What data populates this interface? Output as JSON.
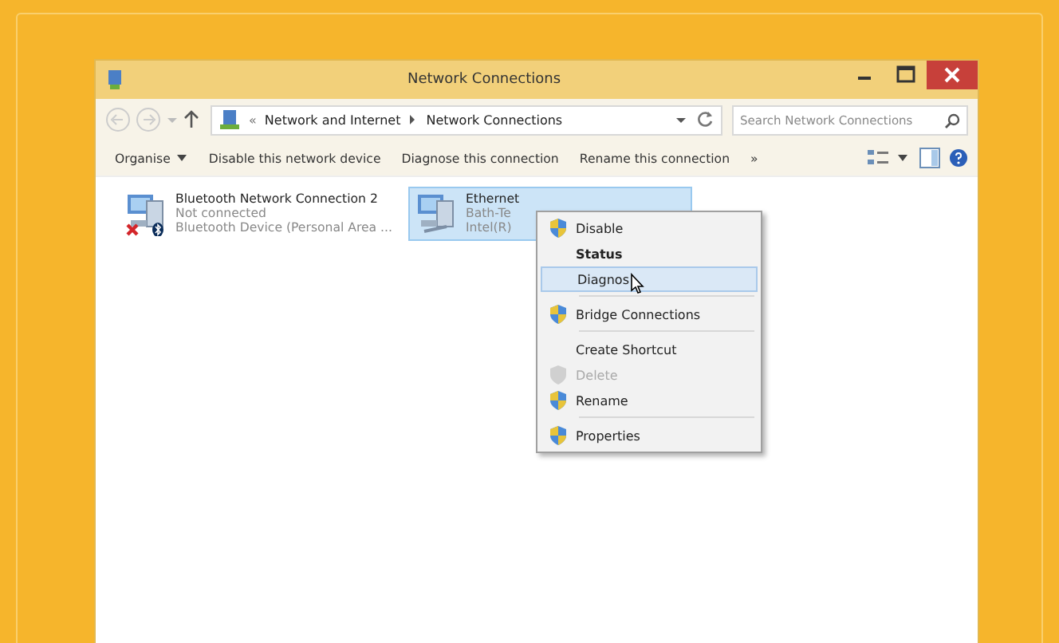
{
  "window": {
    "title": "Network Connections"
  },
  "address_bar": {
    "prefix": "«",
    "path": [
      "Network and Internet",
      "Network Connections"
    ]
  },
  "search": {
    "placeholder": "Search Network Connections"
  },
  "toolbar": {
    "items": [
      {
        "label": "Organise",
        "dropdown": true
      },
      {
        "label": "Disable this network device",
        "dropdown": false
      },
      {
        "label": "Diagnose this connection",
        "dropdown": false
      },
      {
        "label": "Rename this connection",
        "dropdown": false
      },
      {
        "label": "»",
        "dropdown": false
      }
    ]
  },
  "connections": [
    {
      "name": "Bluetooth Network Connection 2",
      "status": "Not connected",
      "device": "Bluetooth Device (Personal Area ...",
      "kind": "bluetooth",
      "selected": false
    },
    {
      "name": "Ethernet",
      "status": "Bath-Te",
      "device": "Intel(R)",
      "kind": "ethernet",
      "selected": true
    }
  ],
  "context_menu": {
    "items": [
      {
        "label": "Disable",
        "shield": true,
        "bold": false,
        "disabled": false,
        "selected": false,
        "separator_after": false
      },
      {
        "label": "Status",
        "shield": false,
        "bold": true,
        "disabled": false,
        "selected": false,
        "separator_after": false
      },
      {
        "label": "Diagnos",
        "shield": false,
        "bold": false,
        "disabled": false,
        "selected": true,
        "separator_after": true
      },
      {
        "label": "Bridge Connections",
        "shield": true,
        "bold": false,
        "disabled": false,
        "selected": false,
        "separator_after": true
      },
      {
        "label": "Create Shortcut",
        "shield": false,
        "bold": false,
        "disabled": false,
        "selected": false,
        "separator_after": false
      },
      {
        "label": "Delete",
        "shield": true,
        "bold": false,
        "disabled": true,
        "selected": false,
        "separator_after": false
      },
      {
        "label": "Rename",
        "shield": true,
        "bold": false,
        "disabled": false,
        "selected": false,
        "separator_after": true
      },
      {
        "label": "Properties",
        "shield": true,
        "bold": false,
        "disabled": false,
        "selected": false,
        "separator_after": false
      }
    ]
  }
}
